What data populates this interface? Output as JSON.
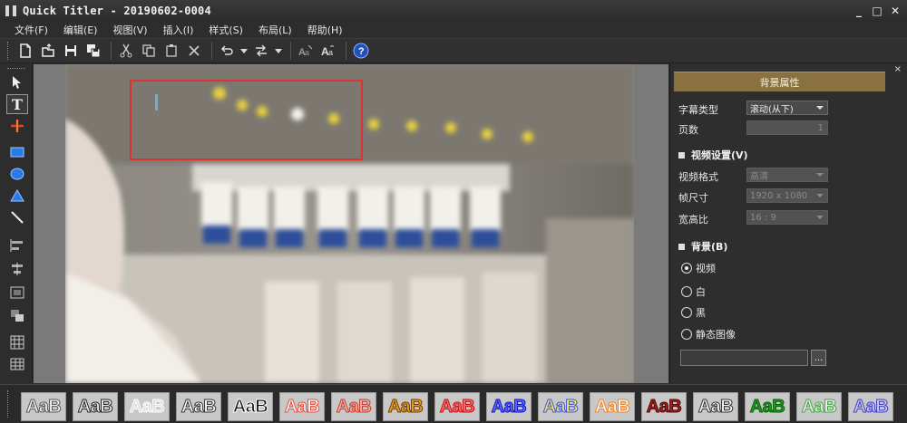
{
  "window": {
    "title": "Quick Titler - 20190602-0004",
    "minimize": "_",
    "maximize": "□",
    "close": "✕"
  },
  "menu": [
    "文件(F)",
    "编辑(E)",
    "视图(V)",
    "插入(I)",
    "样式(S)",
    "布局(L)",
    "帮助(H)"
  ],
  "toolbar": {
    "icons": [
      "new-file-icon",
      "open-file-icon",
      "save-icon",
      "save-as-icon",
      "cut-icon",
      "copy-icon",
      "paste-icon",
      "delete-icon",
      "undo-icon",
      "redo-icon",
      "text-style-icon",
      "text-effect-icon",
      "help-icon"
    ]
  },
  "tools": [
    "pointer-tool",
    "text-tool",
    "move-tool",
    "rectangle-tool",
    "ellipse-tool",
    "triangle-tool",
    "line-tool",
    "align-left-tool",
    "align-center-tool",
    "safe-area-tool",
    "layer-tool",
    "grid-tool",
    "table-tool"
  ],
  "panel": {
    "title": "背景属性",
    "close": "×",
    "subtitle_type_label": "字幕类型",
    "subtitle_type_value": "滚动(从下)",
    "pages_label": "页数",
    "pages_value": "1",
    "video_section": "视频设置(V)",
    "video_format_label": "视频格式",
    "video_format_value": "高清",
    "frame_size_label": "帧尺寸",
    "frame_size_value": "1920 x 1080",
    "aspect_label": "宽高比",
    "aspect_value": "16 : 9",
    "background_section": "背景(B)",
    "bg_options": [
      {
        "label": "视频",
        "selected": true
      },
      {
        "label": "白",
        "selected": false
      },
      {
        "label": "黑",
        "selected": false
      },
      {
        "label": "静态图像",
        "selected": false
      }
    ],
    "browse_label": "..."
  },
  "styles": {
    "tile_text": "AaB",
    "tiles": [
      {
        "fill": "#f4f4f4",
        "stroke": "#555555"
      },
      {
        "fill": "#f0f0f0",
        "stroke": "#222222"
      },
      {
        "fill": "#dddddd",
        "stroke": "#ffffff"
      },
      {
        "fill": "#ffffff",
        "stroke": "#333333"
      },
      {
        "fill": "#111111",
        "stroke": "#ffffff"
      },
      {
        "fill": "#ffffff",
        "stroke": "#e84a3a"
      },
      {
        "fill": "#f6b0a8",
        "stroke": "#c43a2c"
      },
      {
        "fill": "#f0a020",
        "stroke": "#6a3c00"
      },
      {
        "fill": "#ff6a6a",
        "stroke": "#c01010"
      },
      {
        "fill": "#5a6cff",
        "stroke": "#1010c0"
      },
      {
        "fill": "#ffe080",
        "stroke": "#3a58c8"
      },
      {
        "fill": "#ffffff",
        "stroke": "#f08020"
      },
      {
        "fill": "#a81c1c",
        "stroke": "#4a0a0a"
      },
      {
        "fill": "#ffffff",
        "stroke": "#303030"
      },
      {
        "fill": "#1aa01a",
        "stroke": "#0c5a0c"
      },
      {
        "fill": "#e8f8e8",
        "stroke": "#4aa04a"
      },
      {
        "fill": "#c8c8ff",
        "stroke": "#4040c0"
      }
    ]
  },
  "colors": {
    "panel_header": "#8a7240",
    "selection_rect": "#e0302f"
  }
}
